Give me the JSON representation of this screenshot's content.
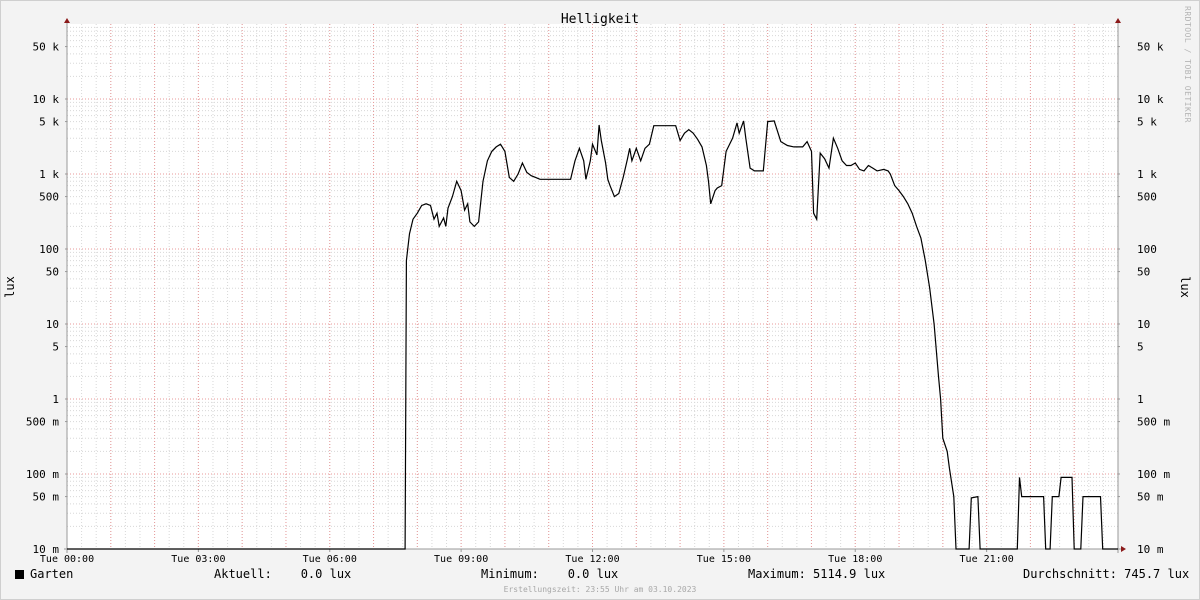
{
  "chart_data": {
    "type": "line",
    "title": "Helligkeit",
    "ylabel": "lux",
    "yscale": "log",
    "ylim": [
      0.01,
      100000
    ],
    "y_ticks": [
      {
        "value": 50000,
        "label": "50 k"
      },
      {
        "value": 10000,
        "label": "10 k"
      },
      {
        "value": 5000,
        "label": "5 k"
      },
      {
        "value": 1000,
        "label": "1 k"
      },
      {
        "value": 500,
        "label": "500"
      },
      {
        "value": 100,
        "label": "100"
      },
      {
        "value": 50,
        "label": "50"
      },
      {
        "value": 10,
        "label": "10"
      },
      {
        "value": 5,
        "label": "5"
      },
      {
        "value": 1,
        "label": "1"
      },
      {
        "value": 0.5,
        "label": "500 m"
      },
      {
        "value": 0.1,
        "label": "100 m"
      },
      {
        "value": 0.05,
        "label": "50 m"
      },
      {
        "value": 0.01,
        "label": "10 m"
      }
    ],
    "x_ticks": [
      {
        "hour": 0,
        "label": "Tue 00:00"
      },
      {
        "hour": 3,
        "label": "Tue 03:00"
      },
      {
        "hour": 6,
        "label": "Tue 06:00"
      },
      {
        "hour": 9,
        "label": "Tue 09:00"
      },
      {
        "hour": 12,
        "label": "Tue 12:00"
      },
      {
        "hour": 15,
        "label": "Tue 15:00"
      },
      {
        "hour": 18,
        "label": "Tue 18:00"
      },
      {
        "hour": 21,
        "label": "Tue 21:00"
      }
    ],
    "xlim_hours": [
      0,
      24
    ],
    "grid": true,
    "series": [
      {
        "name": "Garten",
        "color": "#000000",
        "points": [
          [
            0.0,
            0.01
          ],
          [
            7.72,
            0.01
          ],
          [
            7.75,
            70
          ],
          [
            7.82,
            160
          ],
          [
            7.9,
            250
          ],
          [
            8.0,
            300
          ],
          [
            8.1,
            380
          ],
          [
            8.2,
            400
          ],
          [
            8.3,
            380
          ],
          [
            8.38,
            250
          ],
          [
            8.45,
            300
          ],
          [
            8.5,
            200
          ],
          [
            8.6,
            260
          ],
          [
            8.65,
            200
          ],
          [
            8.7,
            350
          ],
          [
            8.8,
            500
          ],
          [
            8.9,
            800
          ],
          [
            9.0,
            600
          ],
          [
            9.08,
            330
          ],
          [
            9.15,
            400
          ],
          [
            9.2,
            230
          ],
          [
            9.3,
            200
          ],
          [
            9.4,
            230
          ],
          [
            9.5,
            800
          ],
          [
            9.6,
            1500
          ],
          [
            9.7,
            2000
          ],
          [
            9.8,
            2300
          ],
          [
            9.9,
            2500
          ],
          [
            10.0,
            2000
          ],
          [
            10.1,
            900
          ],
          [
            10.2,
            800
          ],
          [
            10.3,
            1000
          ],
          [
            10.4,
            1400
          ],
          [
            10.5,
            1050
          ],
          [
            10.6,
            950
          ],
          [
            10.7,
            900
          ],
          [
            10.8,
            850
          ],
          [
            11.1,
            850
          ],
          [
            11.5,
            850
          ],
          [
            11.6,
            1500
          ],
          [
            11.7,
            2200
          ],
          [
            11.8,
            1500
          ],
          [
            11.85,
            850
          ],
          [
            11.95,
            1500
          ],
          [
            12.0,
            2500
          ],
          [
            12.1,
            1800
          ],
          [
            12.15,
            4500
          ],
          [
            12.2,
            2800
          ],
          [
            12.3,
            1400
          ],
          [
            12.35,
            850
          ],
          [
            12.4,
            700
          ],
          [
            12.5,
            500
          ],
          [
            12.6,
            550
          ],
          [
            12.7,
            900
          ],
          [
            12.8,
            1600
          ],
          [
            12.85,
            2200
          ],
          [
            12.9,
            1500
          ],
          [
            13.0,
            2200
          ],
          [
            13.1,
            1500
          ],
          [
            13.2,
            2200
          ],
          [
            13.3,
            2500
          ],
          [
            13.4,
            4400
          ],
          [
            13.9,
            4400
          ],
          [
            14.0,
            2800
          ],
          [
            14.1,
            3500
          ],
          [
            14.2,
            3900
          ],
          [
            14.3,
            3500
          ],
          [
            14.4,
            2900
          ],
          [
            14.5,
            2300
          ],
          [
            14.6,
            1300
          ],
          [
            14.65,
            800
          ],
          [
            14.7,
            400
          ],
          [
            14.8,
            600
          ],
          [
            14.85,
            650
          ],
          [
            14.95,
            700
          ],
          [
            15.05,
            2000
          ],
          [
            15.2,
            3000
          ],
          [
            15.3,
            4800
          ],
          [
            15.35,
            3500
          ],
          [
            15.45,
            5100
          ],
          [
            15.5,
            3000
          ],
          [
            15.6,
            1200
          ],
          [
            15.7,
            1100
          ],
          [
            15.9,
            1100
          ],
          [
            16.0,
            5000
          ],
          [
            16.15,
            5100
          ],
          [
            16.3,
            2700
          ],
          [
            16.45,
            2400
          ],
          [
            16.6,
            2300
          ],
          [
            16.8,
            2300
          ],
          [
            16.9,
            2700
          ],
          [
            17.0,
            2000
          ],
          [
            17.05,
            300
          ],
          [
            17.12,
            250
          ],
          [
            17.2,
            1900
          ],
          [
            17.3,
            1600
          ],
          [
            17.4,
            1200
          ],
          [
            17.5,
            3000
          ],
          [
            17.6,
            2200
          ],
          [
            17.7,
            1500
          ],
          [
            17.8,
            1300
          ],
          [
            17.9,
            1300
          ],
          [
            18.0,
            1400
          ],
          [
            18.1,
            1150
          ],
          [
            18.2,
            1100
          ],
          [
            18.3,
            1300
          ],
          [
            18.4,
            1200
          ],
          [
            18.5,
            1100
          ],
          [
            18.65,
            1150
          ],
          [
            18.75,
            1100
          ],
          [
            18.8,
            1000
          ],
          [
            18.9,
            700
          ],
          [
            19.0,
            600
          ],
          [
            19.1,
            500
          ],
          [
            19.2,
            400
          ],
          [
            19.3,
            300
          ],
          [
            19.4,
            200
          ],
          [
            19.5,
            140
          ],
          [
            19.6,
            70
          ],
          [
            19.7,
            30
          ],
          [
            19.8,
            10
          ],
          [
            19.9,
            2
          ],
          [
            19.95,
            1
          ],
          [
            20.0,
            0.3
          ],
          [
            20.1,
            0.2
          ],
          [
            20.15,
            0.12
          ],
          [
            20.25,
            0.05
          ],
          [
            20.3,
            0.01
          ],
          [
            20.6,
            0.01
          ],
          [
            20.65,
            0.048
          ],
          [
            20.8,
            0.05
          ],
          [
            20.85,
            0.01
          ],
          [
            21.7,
            0.01
          ],
          [
            21.75,
            0.09
          ],
          [
            21.8,
            0.05
          ],
          [
            22.3,
            0.05
          ],
          [
            22.35,
            0.01
          ],
          [
            22.45,
            0.01
          ],
          [
            22.5,
            0.05
          ],
          [
            22.65,
            0.05
          ],
          [
            22.7,
            0.09
          ],
          [
            22.95,
            0.09
          ],
          [
            23.0,
            0.01
          ],
          [
            23.15,
            0.01
          ],
          [
            23.2,
            0.05
          ],
          [
            23.6,
            0.05
          ],
          [
            23.65,
            0.01
          ],
          [
            24.0,
            0.01
          ]
        ]
      }
    ]
  },
  "legend": {
    "series_name": "Garten",
    "current": "Aktuell:    0.0 lux",
    "minimum": "Minimum:    0.0 lux",
    "maximum": "Maximum: 5114.9 lux",
    "average": "Durchschnitt: 745.7 lux"
  },
  "watermark": "RRDTOOL / TOBI OETIKER",
  "footer": "Erstellungszeit: 23:55 Uhr am 03.10.2023",
  "colors": {
    "background": "#f3f3f3",
    "canvas": "#ffffff",
    "minor_grid": "#d8d8d8",
    "major_grid": "#e89a9a",
    "arrow": "#8b1a1a",
    "line": "#000000"
  }
}
